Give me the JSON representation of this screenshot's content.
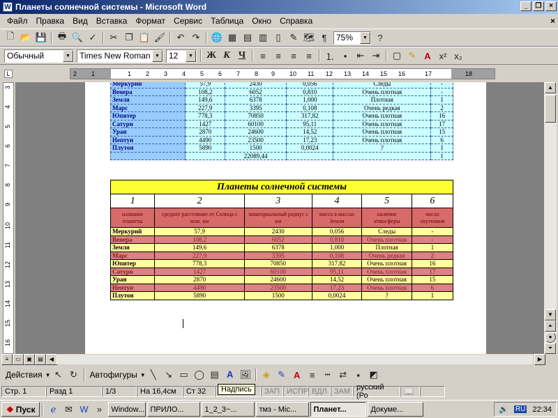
{
  "window": {
    "title": "Планеты солнечной системы - Microsoft Word"
  },
  "menu": [
    "Файл",
    "Правка",
    "Вид",
    "Вставка",
    "Формат",
    "Сервис",
    "Таблица",
    "Окно",
    "Справка"
  ],
  "toolbar": {
    "zoom": "75%"
  },
  "format": {
    "style": "Обычный",
    "font": "Times New Roman",
    "size": "12",
    "bold": "Ж",
    "italic": "К",
    "underline": "Ч"
  },
  "ruler": {
    "h": [
      "2",
      "1",
      "1",
      "2",
      "3",
      "4",
      "5",
      "6",
      "7",
      "8",
      "9",
      "10",
      "11",
      "12",
      "13",
      "14",
      "15",
      "16",
      "17",
      "18"
    ],
    "v": [
      "3",
      "4",
      "5",
      "6",
      "7",
      "8",
      "9",
      "10",
      "11",
      "12",
      "13",
      "14",
      "15",
      "16"
    ]
  },
  "table1": {
    "rows": [
      [
        "Меркурий",
        "57,9",
        "2430",
        "0,056",
        "Следы",
        "-"
      ],
      [
        "Венера",
        "108,2",
        "6052",
        "0,810",
        "Очень плотная",
        "-"
      ],
      [
        "Земля",
        "149,6",
        "6378",
        "1,000",
        "Плотная",
        "1"
      ],
      [
        "Марс",
        "227,9",
        "3395",
        "0,108",
        "Очень редкая",
        "2"
      ],
      [
        "Юпитер",
        "778,3",
        "70850",
        "317,82",
        "Очень плотная",
        "16"
      ],
      [
        "Сатурн",
        "1427",
        "60100",
        "95,11",
        "Очень плотная",
        "17"
      ],
      [
        "Уран",
        "2870",
        "24600",
        "14,52",
        "Очень плотная",
        "15"
      ],
      [
        "Нептун",
        "4490",
        "23500",
        "17,23",
        "Очень плотная",
        "6"
      ],
      [
        "Плутон",
        "5890",
        "1500",
        "0,0024",
        "?",
        "1"
      ],
      [
        "",
        "",
        "22089,44",
        "",
        "",
        "1"
      ]
    ]
  },
  "table2": {
    "title": "Планеты солнечной системы",
    "numbers": [
      "1",
      "2",
      "3",
      "4",
      "5",
      "6"
    ],
    "headers": [
      "название планеты",
      "среднее расстояние от Солнца с млн. км",
      "экваториальный радиус с км",
      "масса в массах Земли",
      "наличие атмосферы",
      "число спутников"
    ],
    "rows": [
      [
        "Меркурий",
        "57,9",
        "2430",
        "0,056",
        "Следы",
        "-"
      ],
      [
        "Венера",
        "108,2",
        "6052",
        "0,810",
        "Очень плотная",
        "-"
      ],
      [
        "Земля",
        "149,6",
        "6378",
        "1,000",
        "Плотная",
        "1"
      ],
      [
        "Марс",
        "227,9",
        "3395",
        "0,108",
        "Очень редкая",
        "2"
      ],
      [
        "Юпитер",
        "778,3",
        "70850",
        "317,82",
        "Очень плотная",
        "16"
      ],
      [
        "Сатурн",
        "1427",
        "60100",
        "95,11",
        "Очень плотная",
        "17"
      ],
      [
        "Уран",
        "2870",
        "24600",
        "14,52",
        "Очень плотная",
        "15"
      ],
      [
        "Нептун",
        "4490",
        "23500",
        "17,23",
        "Очень плотная",
        "6"
      ],
      [
        "Плутон",
        "5890",
        "1500",
        "0,0024",
        "?",
        "1"
      ]
    ]
  },
  "drawbar": {
    "actions": "Действия",
    "autoshapes": "Автофигуры"
  },
  "tooltip": "Надпись",
  "status": {
    "page": "Стр. 1",
    "section": "Разд 1",
    "pages": "1/3",
    "pos": "На 16,4см",
    "line": "Ст 32",
    "rec": "ЗАП",
    "trk": "ИСПР",
    "ext": "ВДЛ",
    "ovr": "ЗАМ",
    "lang": "русский (Ро"
  },
  "taskbar": {
    "start": "Пуск",
    "tasks": [
      "Window...",
      "ПРИЛО...",
      "1_2_3~...",
      "тмз - Mic...",
      "Планет...",
      "Докуме..."
    ],
    "active_index": 4,
    "lang": "RU",
    "clock": "22:34"
  }
}
